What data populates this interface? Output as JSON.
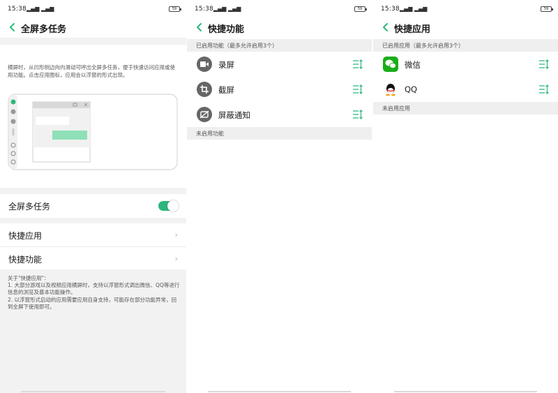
{
  "screen1": {
    "status": {
      "time": "15:38",
      "signal": "³ᴰ⸏⸏⸏ ⸏",
      "battery": "59"
    },
    "title": "全屏多任务",
    "description": "横屏时，从凹形侧边向内滑动可呼出全屏多任务，便于快速访问应用或使用功能。点击应用图标，应用会以浮窗的形式出现。",
    "toggle_row": {
      "label": "全屏多任务",
      "enabled": true
    },
    "rows": [
      {
        "label": "快捷应用"
      },
      {
        "label": "快捷功能"
      }
    ],
    "note_lines": [
      "关于\"快捷应用\"：",
      "1. 大部分游戏以及视频应用横屏时，支持以浮窗形式调出微信、QQ等进行信息的浏览及基本功能操作。",
      "2. 以浮窗形式启动的应用需要应用自身支持，可能存在部分功能异常，回到全屏下使用即可。"
    ]
  },
  "screen2": {
    "status": {
      "time": "15:38",
      "signal": "⸏⸏ ⸏",
      "battery": "59"
    },
    "title": "快捷功能",
    "enabled_header": "已启用功能（最多允许启用3个）",
    "items": [
      {
        "label": "录屏",
        "icon": "video-camera-icon"
      },
      {
        "label": "截屏",
        "icon": "crop-icon"
      },
      {
        "label": "屏蔽通知",
        "icon": "notification-off-icon"
      }
    ],
    "disabled_header": "未启用功能"
  },
  "screen3": {
    "status": {
      "time": "15:38",
      "signal": "⸏⸏ ⸏",
      "battery": "59"
    },
    "title": "快捷应用",
    "enabled_header": "已启用应用（最多允许启用3个）",
    "items": [
      {
        "label": "微信",
        "icon": "wechat-icon"
      },
      {
        "label": "QQ",
        "icon": "qq-icon"
      }
    ],
    "disabled_header": "未启用应用"
  },
  "colors": {
    "accent": "#2cb67d",
    "wechat": "#1aad19",
    "section_bg": "#efefef",
    "icon_gray": "#666666"
  }
}
